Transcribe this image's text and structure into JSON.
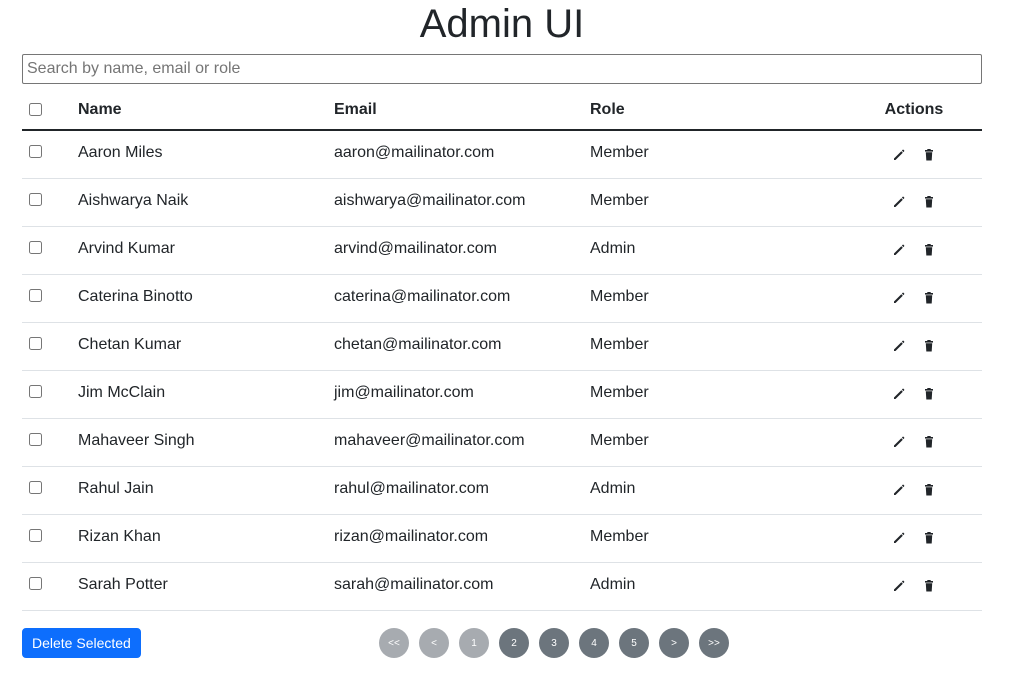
{
  "page": {
    "title": "Admin UI"
  },
  "search": {
    "placeholder": "Search by name, email or role",
    "value": ""
  },
  "table": {
    "headers": {
      "name": "Name",
      "email": "Email",
      "role": "Role",
      "actions": "Actions"
    },
    "rows": [
      {
        "name": "Aaron Miles",
        "email": "aaron@mailinator.com",
        "role": "Member"
      },
      {
        "name": "Aishwarya Naik",
        "email": "aishwarya@mailinator.com",
        "role": "Member"
      },
      {
        "name": "Arvind Kumar",
        "email": "arvind@mailinator.com",
        "role": "Admin"
      },
      {
        "name": "Caterina Binotto",
        "email": "caterina@mailinator.com",
        "role": "Member"
      },
      {
        "name": "Chetan Kumar",
        "email": "chetan@mailinator.com",
        "role": "Member"
      },
      {
        "name": "Jim McClain",
        "email": "jim@mailinator.com",
        "role": "Member"
      },
      {
        "name": "Mahaveer Singh",
        "email": "mahaveer@mailinator.com",
        "role": "Member"
      },
      {
        "name": "Rahul Jain",
        "email": "rahul@mailinator.com",
        "role": "Admin"
      },
      {
        "name": "Rizan Khan",
        "email": "rizan@mailinator.com",
        "role": "Member"
      },
      {
        "name": "Sarah Potter",
        "email": "sarah@mailinator.com",
        "role": "Admin"
      }
    ],
    "row_action_icons": [
      "pencil-icon",
      "trash-icon"
    ]
  },
  "footer": {
    "delete_selected_label": "Delete Selected"
  },
  "pagination": {
    "first_label": "<<",
    "prev_label": "<",
    "pages": [
      "1",
      "2",
      "3",
      "4",
      "5"
    ],
    "current_page": "1",
    "next_label": ">",
    "last_label": ">>"
  },
  "colors": {
    "primary": "#0d6efd",
    "pager": "#6c757d",
    "pager_disabled": "#a7abb0"
  }
}
